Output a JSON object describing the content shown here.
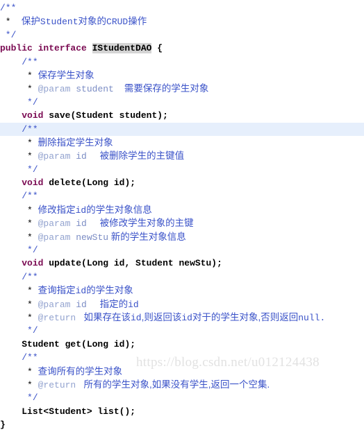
{
  "editor": {
    "language": "java",
    "background_color": "#ffffff",
    "highlight_color": "#e6efFC",
    "selection_color": "#d4d4d4",
    "comment_color": "#3a52c8",
    "keyword_color": "#7a0a52",
    "tag_color": "#93a3cf",
    "caret_line": 9
  },
  "watermark": {
    "text": "https://blog.csdn.net/u012124438"
  },
  "code": {
    "lines": [
      {
        "n": 1,
        "highlight": false,
        "indent": 0,
        "tokens": [
          {
            "t": "cmt-delim",
            "v": "/**"
          }
        ]
      },
      {
        "n": 2,
        "highlight": false,
        "indent": 0,
        "tokens": [
          {
            "t": "cmt-star",
            "v": " * "
          },
          {
            "t": "cmt-text",
            "v": "  保护"
          },
          {
            "t": "cmt-mono",
            "v": "Student"
          },
          {
            "t": "cmt-text",
            "v": "对象的"
          },
          {
            "t": "cmt-mono",
            "v": "CRUD"
          },
          {
            "t": "cmt-text",
            "v": "操作"
          }
        ]
      },
      {
        "n": 3,
        "highlight": false,
        "indent": 0,
        "tokens": [
          {
            "t": "cmt-delim",
            "v": " */"
          }
        ]
      },
      {
        "n": 4,
        "highlight": false,
        "indent": 0,
        "tokens": [
          {
            "t": "kw",
            "v": "public interface "
          },
          {
            "t": "type-sel",
            "v": "IStudentDAO"
          },
          {
            "t": "brace",
            "v": " {"
          }
        ]
      },
      {
        "n": 5,
        "highlight": false,
        "indent": 4,
        "tokens": [
          {
            "t": "cmt-delim",
            "v": "/**"
          }
        ]
      },
      {
        "n": 6,
        "highlight": false,
        "indent": 4,
        "tokens": [
          {
            "t": "cmt-star",
            "v": " * "
          },
          {
            "t": "cmt-text",
            "v": "保存学生对象"
          }
        ]
      },
      {
        "n": 7,
        "highlight": false,
        "indent": 4,
        "tokens": [
          {
            "t": "cmt-star",
            "v": " * "
          },
          {
            "t": "tag",
            "v": "@param"
          },
          {
            "t": "tagname",
            "v": " student"
          },
          {
            "t": "cmt-text",
            "v": "    需要保存的学生对象"
          }
        ]
      },
      {
        "n": 8,
        "highlight": false,
        "indent": 4,
        "tokens": [
          {
            "t": "cmt-delim",
            "v": " */"
          }
        ]
      },
      {
        "n": 9,
        "highlight": false,
        "indent": 4,
        "tokens": [
          {
            "t": "kw",
            "v": "void"
          },
          {
            "t": "plain",
            "v": " save(Student student);"
          }
        ]
      },
      {
        "n": 10,
        "highlight": true,
        "indent": 4,
        "tokens": [
          {
            "t": "cmt-delim",
            "v": "/**"
          }
        ]
      },
      {
        "n": 11,
        "highlight": false,
        "indent": 4,
        "tokens": [
          {
            "t": "cmt-star",
            "v": " * "
          },
          {
            "t": "cmt-text",
            "v": "删除指定学生对象"
          }
        ]
      },
      {
        "n": 12,
        "highlight": false,
        "indent": 4,
        "tokens": [
          {
            "t": "cmt-star",
            "v": " * "
          },
          {
            "t": "tag",
            "v": "@param"
          },
          {
            "t": "tagname",
            "v": " id"
          },
          {
            "t": "cmt-text",
            "v": "     被删除学生的主键值"
          }
        ]
      },
      {
        "n": 13,
        "highlight": false,
        "indent": 4,
        "tokens": [
          {
            "t": "cmt-delim",
            "v": " */"
          }
        ]
      },
      {
        "n": 14,
        "highlight": false,
        "indent": 4,
        "tokens": [
          {
            "t": "kw",
            "v": "void"
          },
          {
            "t": "plain",
            "v": " delete(Long id);"
          }
        ]
      },
      {
        "n": 15,
        "highlight": false,
        "indent": 4,
        "tokens": [
          {
            "t": "cmt-delim",
            "v": "/**"
          }
        ]
      },
      {
        "n": 16,
        "highlight": false,
        "indent": 4,
        "tokens": [
          {
            "t": "cmt-star",
            "v": " * "
          },
          {
            "t": "cmt-text",
            "v": "修改指定"
          },
          {
            "t": "cmt-mono",
            "v": "id"
          },
          {
            "t": "cmt-text",
            "v": "的学生对象信息"
          }
        ]
      },
      {
        "n": 17,
        "highlight": false,
        "indent": 4,
        "tokens": [
          {
            "t": "cmt-star",
            "v": " * "
          },
          {
            "t": "tag",
            "v": "@param"
          },
          {
            "t": "tagname",
            "v": " id"
          },
          {
            "t": "cmt-text",
            "v": "     被修改学生对象的主键"
          }
        ]
      },
      {
        "n": 18,
        "highlight": false,
        "indent": 4,
        "tokens": [
          {
            "t": "cmt-star",
            "v": " * "
          },
          {
            "t": "tag",
            "v": "@param"
          },
          {
            "t": "tagname",
            "v": " newStu"
          },
          {
            "t": "cmt-text",
            "v": " 新的学生对象信息"
          }
        ]
      },
      {
        "n": 19,
        "highlight": false,
        "indent": 4,
        "tokens": [
          {
            "t": "cmt-delim",
            "v": " */"
          }
        ]
      },
      {
        "n": 20,
        "highlight": false,
        "indent": 4,
        "tokens": [
          {
            "t": "kw",
            "v": "void"
          },
          {
            "t": "plain",
            "v": " update(Long id, Student newStu);"
          }
        ]
      },
      {
        "n": 21,
        "highlight": false,
        "indent": 4,
        "tokens": [
          {
            "t": "cmt-delim",
            "v": "/**"
          }
        ]
      },
      {
        "n": 22,
        "highlight": false,
        "indent": 4,
        "tokens": [
          {
            "t": "cmt-star",
            "v": " * "
          },
          {
            "t": "cmt-text",
            "v": "查询指定"
          },
          {
            "t": "cmt-mono",
            "v": "id"
          },
          {
            "t": "cmt-text",
            "v": "的学生对象"
          }
        ]
      },
      {
        "n": 23,
        "highlight": false,
        "indent": 4,
        "tokens": [
          {
            "t": "cmt-star",
            "v": " * "
          },
          {
            "t": "tag",
            "v": "@param"
          },
          {
            "t": "tagname",
            "v": " id"
          },
          {
            "t": "cmt-text",
            "v": "     指定的"
          },
          {
            "t": "cmt-mono",
            "v": "id"
          }
        ]
      },
      {
        "n": 24,
        "highlight": false,
        "indent": 4,
        "tokens": [
          {
            "t": "cmt-star",
            "v": " * "
          },
          {
            "t": "tag",
            "v": "@return"
          },
          {
            "t": "cmt-text",
            "v": "   如果存在该"
          },
          {
            "t": "cmt-mono",
            "v": "id"
          },
          {
            "t": "cmt-text",
            "v": ",则返回该"
          },
          {
            "t": "cmt-mono",
            "v": "id"
          },
          {
            "t": "cmt-text",
            "v": "对于的学生对象,否则返回"
          },
          {
            "t": "cmt-mono",
            "v": "null."
          }
        ]
      },
      {
        "n": 25,
        "highlight": false,
        "indent": 4,
        "tokens": [
          {
            "t": "cmt-delim",
            "v": " */"
          }
        ]
      },
      {
        "n": 26,
        "highlight": false,
        "indent": 4,
        "tokens": [
          {
            "t": "plain",
            "v": "Student get(Long id);"
          }
        ]
      },
      {
        "n": 27,
        "highlight": false,
        "indent": 4,
        "tokens": [
          {
            "t": "cmt-delim",
            "v": "/**"
          }
        ]
      },
      {
        "n": 28,
        "highlight": false,
        "indent": 4,
        "tokens": [
          {
            "t": "cmt-star",
            "v": " * "
          },
          {
            "t": "cmt-text",
            "v": "查询所有的学生对象"
          }
        ]
      },
      {
        "n": 29,
        "highlight": false,
        "indent": 4,
        "tokens": [
          {
            "t": "cmt-star",
            "v": " * "
          },
          {
            "t": "tag",
            "v": "@return"
          },
          {
            "t": "cmt-text",
            "v": "   所有的学生对象,如果没有学生,返回一个空集."
          }
        ]
      },
      {
        "n": 30,
        "highlight": false,
        "indent": 4,
        "tokens": [
          {
            "t": "cmt-delim",
            "v": " */"
          }
        ]
      },
      {
        "n": 31,
        "highlight": false,
        "indent": 4,
        "tokens": [
          {
            "t": "plain",
            "v": "List<Student> list();"
          }
        ]
      },
      {
        "n": 32,
        "highlight": false,
        "indent": 0,
        "tokens": [
          {
            "t": "brace",
            "v": "}"
          }
        ]
      }
    ]
  }
}
